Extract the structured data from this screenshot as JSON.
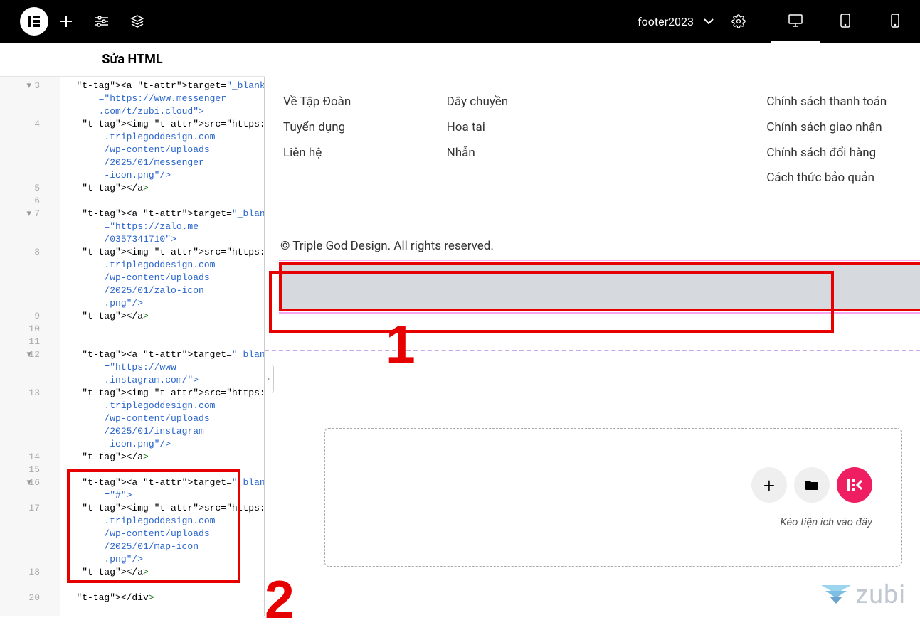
{
  "topbar": {
    "doc_name": "footer2023"
  },
  "panel": {
    "title": "Sửa HTML"
  },
  "code": {
    "line_numbers": [
      "3",
      "4",
      "5",
      "6",
      "7",
      "8",
      "9",
      "10",
      "11",
      "12",
      "13",
      "14",
      "15",
      "16",
      "17",
      "18",
      "",
      "20"
    ],
    "lines": [
      "   <a target=\"_blank\" href",
      "       =\"https://www.messenger",
      "       .com/t/zubi.cloud\">",
      "    <img src=\"https://www",
      "        .triplegoddesign.com",
      "        /wp-content/uploads",
      "        /2025/01/messenger",
      "        -icon.png\"/>",
      "    </a>",
      "",
      "    <a target=\"_blank\" href",
      "        =\"https://zalo.me",
      "        /0357341710\">",
      "    <img src=\"https://www",
      "        .triplegoddesign.com",
      "        /wp-content/uploads",
      "        /2025/01/zalo-icon",
      "        .png\"/>",
      "    </a>",
      "",
      "",
      "    <a target=\"_blank\" href",
      "        =\"https://www",
      "        .instagram.com/\">",
      "    <img src=\"https://www",
      "        .triplegoddesign.com",
      "        /wp-content/uploads",
      "        /2025/01/instagram",
      "        -icon.png\"/>",
      "    </a>",
      "",
      "    <a target=\"_blank\" href",
      "        =\"#\">",
      "    <img src=\"https://www",
      "        .triplegoddesign.com",
      "        /wp-content/uploads",
      "        /2025/01/map-icon",
      "        .png\"/>",
      "    </a>",
      "",
      "   </div>"
    ]
  },
  "footer": {
    "col1": [
      "Về Tập Đoàn",
      "Tuyển dụng",
      "Liên hệ"
    ],
    "col2": [
      "Dây chuyền",
      "Hoa tai",
      "Nhẫn"
    ],
    "col3": [
      "Chính sách thanh toán",
      "Chính sách giao nhận",
      "Chính sách đổi hàng",
      "Cách thức bảo quản"
    ],
    "copyright": "© Triple God Design. All rights reserved."
  },
  "drop": {
    "text": "Kéo tiện ích vào đây",
    "brand_letters": "E‹"
  },
  "brand": {
    "zubi": "zubi"
  },
  "annotations": {
    "n1": "1",
    "n2": "2"
  }
}
